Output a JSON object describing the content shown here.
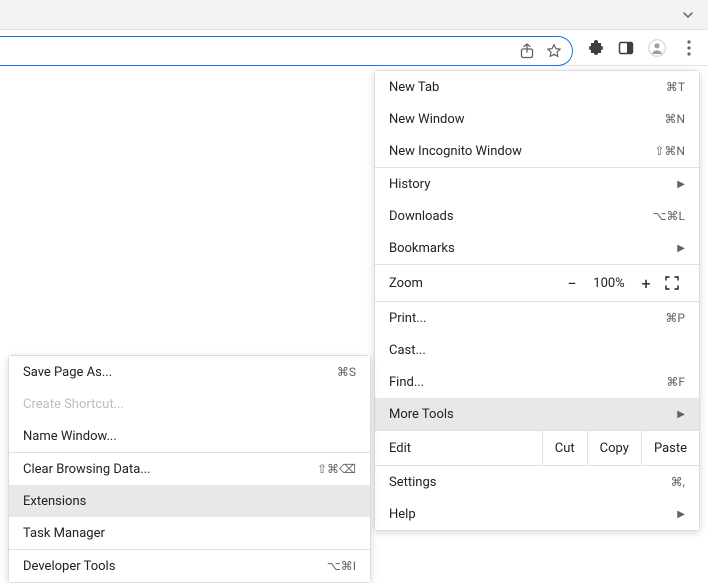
{
  "mainMenu": {
    "newTab": {
      "label": "New Tab",
      "shortcut": "⌘T"
    },
    "newWindow": {
      "label": "New Window",
      "shortcut": "⌘N"
    },
    "newIncognito": {
      "label": "New Incognito Window",
      "shortcut": "⇧⌘N"
    },
    "history": {
      "label": "History"
    },
    "downloads": {
      "label": "Downloads",
      "shortcut": "⌥⌘L"
    },
    "bookmarks": {
      "label": "Bookmarks"
    },
    "zoomLabel": "Zoom",
    "zoomValue": "100%",
    "print": {
      "label": "Print...",
      "shortcut": "⌘P"
    },
    "cast": {
      "label": "Cast..."
    },
    "find": {
      "label": "Find...",
      "shortcut": "⌘F"
    },
    "moreTools": {
      "label": "More Tools"
    },
    "editLabel": "Edit",
    "cut": "Cut",
    "copy": "Copy",
    "paste": "Paste",
    "settings": {
      "label": "Settings",
      "shortcut": "⌘,"
    },
    "help": {
      "label": "Help"
    }
  },
  "subMenu": {
    "savePageAs": {
      "label": "Save Page As...",
      "shortcut": "⌘S"
    },
    "createShortcut": {
      "label": "Create Shortcut..."
    },
    "nameWindow": {
      "label": "Name Window..."
    },
    "clearBrowsingData": {
      "label": "Clear Browsing Data...",
      "shortcut": "⇧⌘⌫"
    },
    "extensions": {
      "label": "Extensions"
    },
    "taskManager": {
      "label": "Task Manager"
    },
    "developerTools": {
      "label": "Developer Tools",
      "shortcut": "⌥⌘I"
    }
  }
}
